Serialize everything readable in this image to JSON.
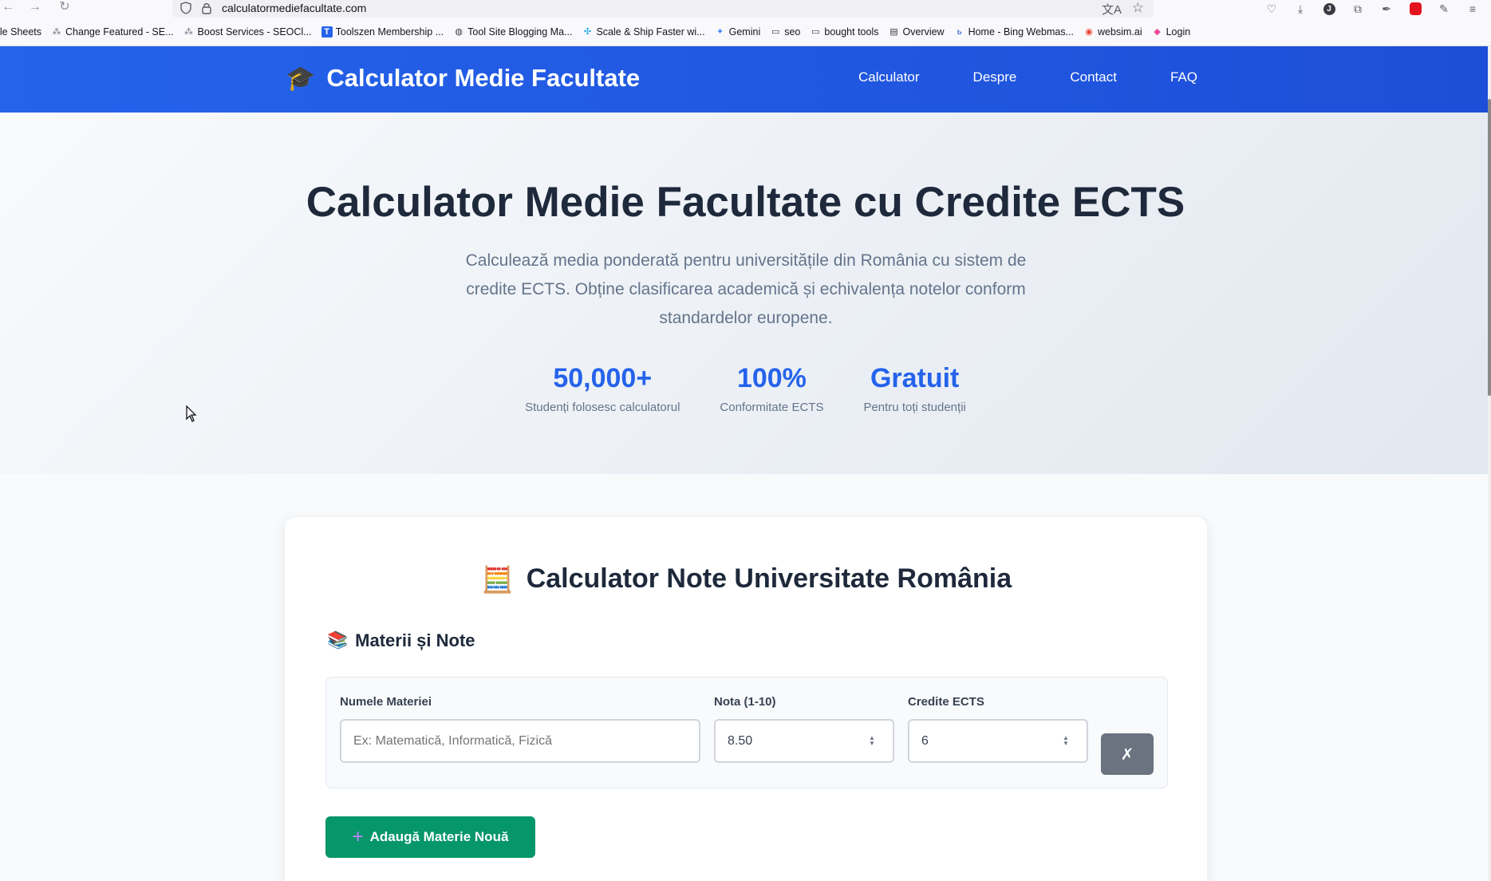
{
  "browser": {
    "url": "calculatormediefacultate.com",
    "bookmarks": [
      {
        "label": "ogle Sheets",
        "icon": "none"
      },
      {
        "label": "Change Featured - SE...",
        "icon": "network-icon"
      },
      {
        "label": "Boost Services - SEOCl...",
        "icon": "network-icon"
      },
      {
        "label": "Toolszen Membership ...",
        "icon": "t-badge-icon"
      },
      {
        "label": "Tool Site Blogging Ma...",
        "icon": "globe-icon"
      },
      {
        "label": "Scale & Ship Faster wi...",
        "icon": "sparkle-icon"
      },
      {
        "label": "Gemini",
        "icon": "gemini-icon"
      },
      {
        "label": "seo",
        "icon": "folder-icon"
      },
      {
        "label": "bought tools",
        "icon": "folder-icon"
      },
      {
        "label": "Overview",
        "icon": "overview-icon"
      },
      {
        "label": "Home - Bing Webmas...",
        "icon": "bing-icon"
      },
      {
        "label": "websim.ai",
        "icon": "websim-icon"
      },
      {
        "label": "Login",
        "icon": "login-icon"
      }
    ]
  },
  "header": {
    "logo_icon": "🎓",
    "logo_text": "Calculator Medie Facultate",
    "nav": [
      "Calculator",
      "Despre",
      "Contact",
      "FAQ"
    ]
  },
  "hero": {
    "title": "Calculator Medie Facultate cu Credite ECTS",
    "subtitle": "Calculează media ponderată pentru universitățile din România cu sistem de credite ECTS. Obține clasificarea academică și echivalența notelor conform standardelor europene.",
    "stats": [
      {
        "value": "50,000+",
        "label": "Studenți folosesc calculatorul"
      },
      {
        "value": "100%",
        "label": "Conformitate ECTS"
      },
      {
        "value": "Gratuit",
        "label": "Pentru toți studenții"
      }
    ]
  },
  "calculator": {
    "title_icon": "🧮",
    "title": "Calculator Note Universitate România",
    "section_icon": "📚",
    "section_title": "Materii și Note",
    "subject_label": "Numele Materiei",
    "subject_placeholder": "Ex: Matematică, Informatică, Fizică",
    "grade_label": "Nota (1-10)",
    "grade_value": "8.50",
    "credits_label": "Credite ECTS",
    "credits_value": "6",
    "remove_label": "✗",
    "add_label": "Adaugă Materie Nouă"
  },
  "colors": {
    "brand": "#2563eb",
    "add_button": "#059669",
    "remove_button": "#6b7280"
  }
}
